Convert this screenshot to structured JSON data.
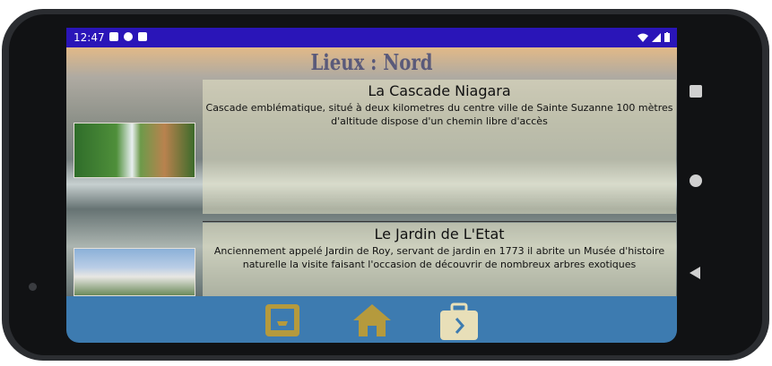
{
  "status": {
    "time": "12:47"
  },
  "header": {
    "title": "Lieux : Nord"
  },
  "places": [
    {
      "title": "La Cascade Niagara",
      "desc_line1": "Cascade emblématique, situé à deux kilometres du centre ville de Sainte Suzanne 100 mètres",
      "desc_line2": "d'altitude dispose d'un chemin libre d'accès"
    },
    {
      "title": "Le Jardin de L'Etat",
      "desc_line1": "Anciennement appelé Jardin de Roy, servant de jardin en 1773 il abrite un Musée d'histoire",
      "desc_line2": "naturelle la visite faisant l'occasion de découvrir de nombreux arbres exotiques"
    }
  ],
  "nav": {
    "icons": [
      "inbox-tray-icon",
      "home-icon",
      "briefcase-forward-icon"
    ]
  },
  "colors": {
    "status_bar": "#2a15b8",
    "bottom_bar": "#3d7bb0",
    "icon_gold": "#b59a3d"
  }
}
